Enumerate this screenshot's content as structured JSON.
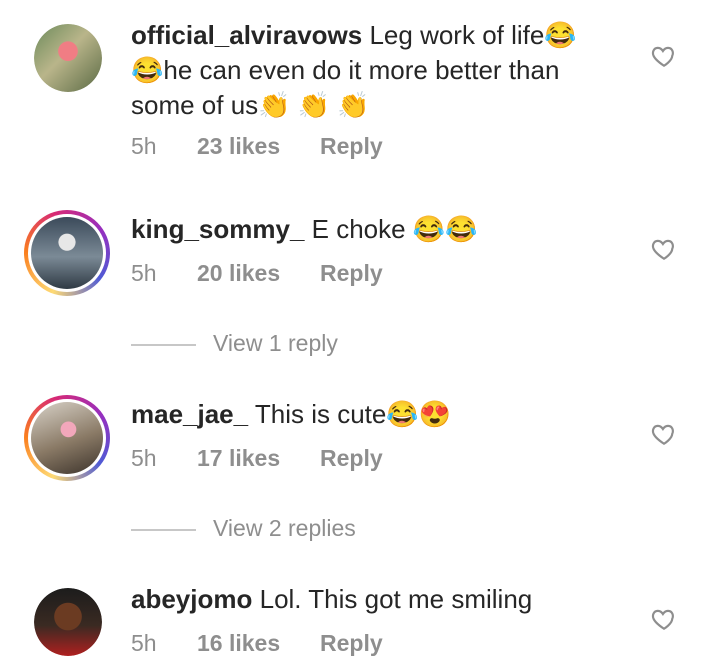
{
  "comments": [
    {
      "username": "official_alviravows",
      "text": "Leg work of life😂😂he can even do it more better than some of us👏 👏 👏",
      "time": "5h",
      "likes": "23 likes",
      "reply": "Reply"
    },
    {
      "username": "king_sommy_",
      "text": "E choke 😂😂",
      "time": "5h",
      "likes": "20 likes",
      "reply": "Reply",
      "view_replies": "View 1 reply"
    },
    {
      "username": "mae_jae_",
      "text": "This is cute😂😍",
      "time": "5h",
      "likes": "17 likes",
      "reply": "Reply",
      "view_replies": "View 2 replies"
    },
    {
      "username": "abeyjomo",
      "text": "Lol. This got me smiling",
      "time": "5h",
      "likes": "16 likes",
      "reply": "Reply"
    }
  ],
  "colors": {
    "meta": "#8e8e8e",
    "text": "#262626"
  }
}
